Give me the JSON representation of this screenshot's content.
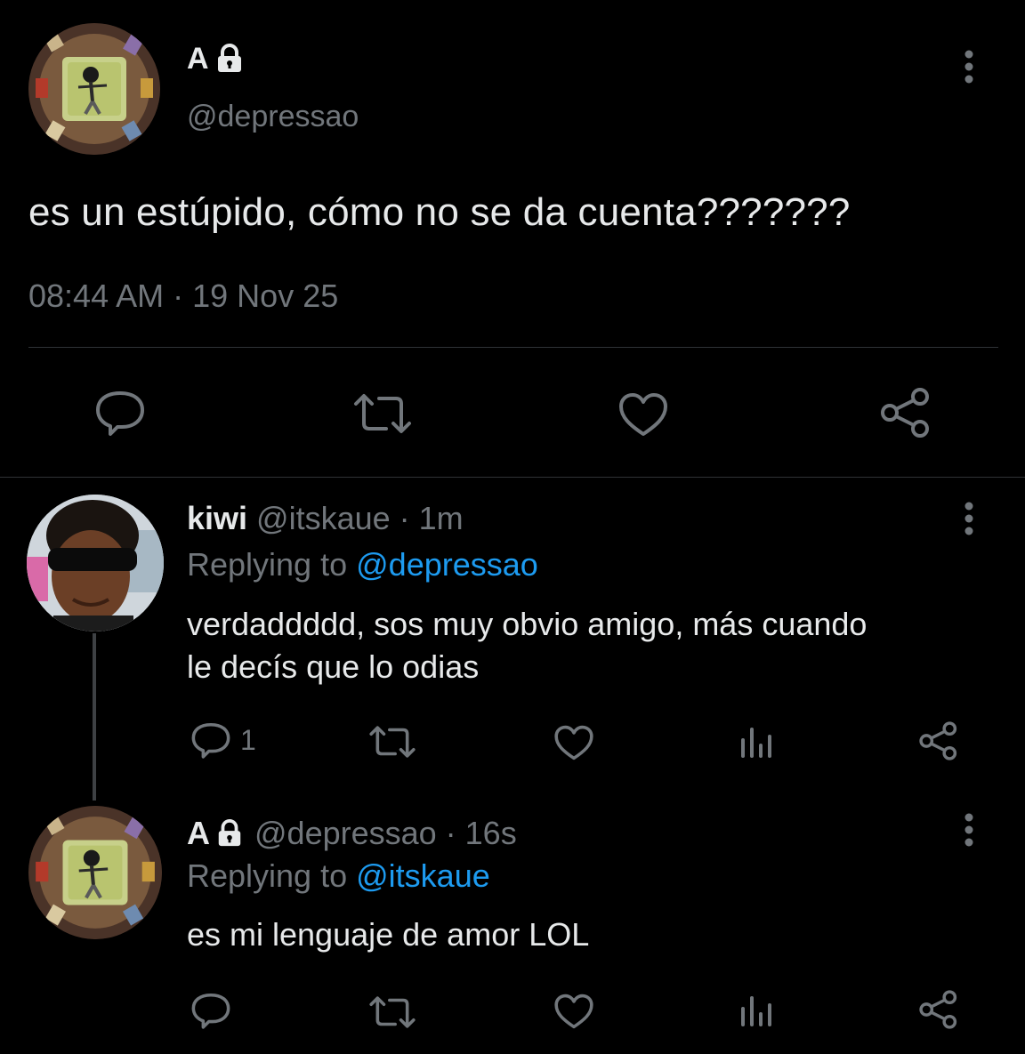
{
  "main_tweet": {
    "display_name": "A",
    "handle": "@depressao",
    "text": "es un estúpido, cómo no se da cuenta???????",
    "timestamp": "08:44 AM",
    "separator": "·",
    "date": "19 Nov 25",
    "icons": [
      "more-vertical-icon",
      "reply-icon",
      "retweet-icon",
      "like-icon",
      "share-icon",
      "lock-icon"
    ]
  },
  "replies": [
    {
      "display_name": "kiwi",
      "handle": "@itskaue",
      "time": "· 1m",
      "replying_prefix": "Replying to",
      "replying_to": "@depressao",
      "text_line1": "verdaddddd, sos muy obvio amigo, más cuando",
      "text_line2": "le decís que lo odias",
      "reply_count": "1"
    },
    {
      "display_name": "A",
      "handle": "@depressao",
      "time": "· 16s",
      "replying_prefix": "Replying to",
      "replying_to": "@itskaue",
      "text": "es mi lenguaje de amor LOL"
    }
  ],
  "colors": {
    "background": "#000000",
    "text": "#e7e9ea",
    "muted": "#71767b",
    "link": "#1d9bf0",
    "divider": "#2f3336"
  }
}
